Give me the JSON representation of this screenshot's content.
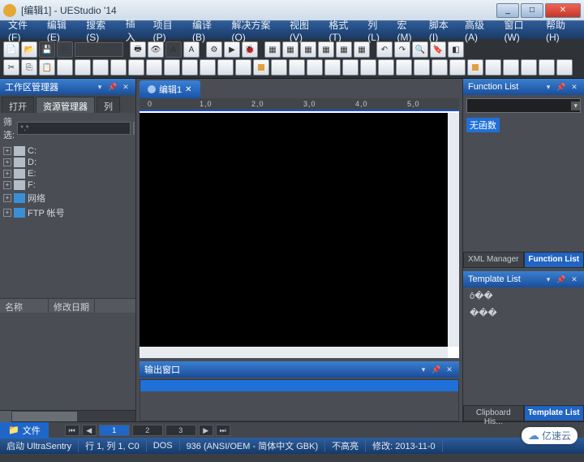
{
  "title": "[编辑1] - UEStudio '14",
  "winbtns": {
    "min": "_",
    "max": "□",
    "close": "✕"
  },
  "menu": [
    "文件(F)",
    "编辑(E)",
    "搜索(S)",
    "插入",
    "项目(P)",
    "编译(B)",
    "解决方案(O)",
    "视图(V)",
    "格式(T)",
    "列(L)",
    "宏(M)",
    "脚本(I)",
    "高级(A)",
    "窗口(W)",
    "帮助(H)"
  ],
  "left": {
    "header": "工作区管理器",
    "tabs": [
      "打开",
      "资源管理器",
      "列"
    ],
    "active_tab": 1,
    "filter_label": "筛选:",
    "filter_value": "*.*",
    "tree": [
      {
        "label": "C:"
      },
      {
        "label": "D:"
      },
      {
        "label": "E:"
      },
      {
        "label": "F:"
      },
      {
        "label": "网络"
      },
      {
        "label": "FTP 帐号"
      }
    ],
    "cols": [
      "名称",
      "修改日期"
    ]
  },
  "center": {
    "filetab": "编辑1",
    "ruler": [
      "0",
      "1,0",
      "2,0",
      "3,0",
      "4,0",
      "5,0"
    ],
    "output_header": "输出窗口"
  },
  "right": {
    "func_header": "Function List",
    "noarg": "无函数",
    "bottom_tabs_func": [
      "XML Manager",
      "Function List"
    ],
    "tmpl_header": "Template List",
    "tmpl_items": [
      "ô��",
      "���"
    ],
    "bottom_tabs_tmpl": [
      "Clipboard His...",
      "Template List"
    ]
  },
  "bottom": {
    "files": "文件",
    "pages": [
      "1",
      "2",
      "3"
    ]
  },
  "status": {
    "launch": "启动 UltraSentry",
    "pos": "行 1, 列 1, C0",
    "dos": "DOS",
    "cp": "936  (ANSI/OEM - 简体中文 GBK)",
    "lock": "不高亮",
    "mod": "修改: 2013-11-0"
  },
  "watermark": "亿速云"
}
